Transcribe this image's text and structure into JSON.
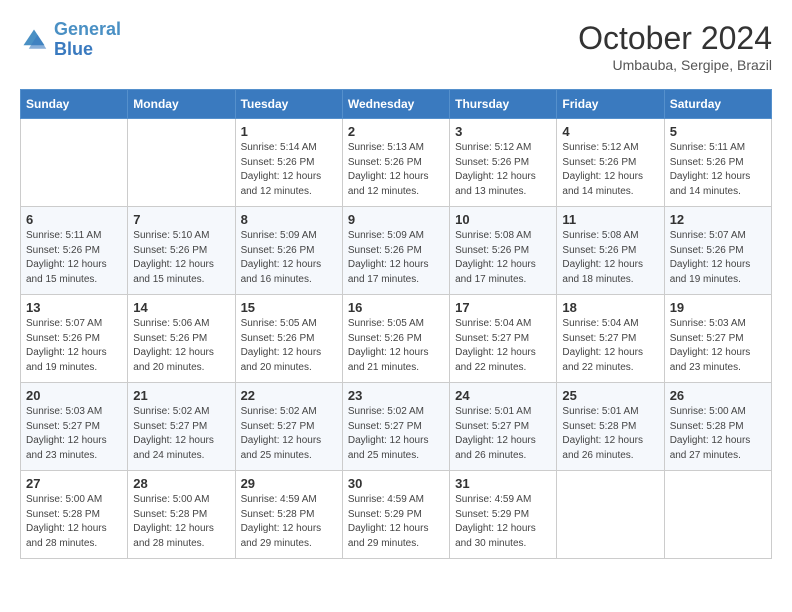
{
  "header": {
    "logo_line1": "General",
    "logo_line2": "Blue",
    "month": "October 2024",
    "location": "Umbauba, Sergipe, Brazil"
  },
  "days_of_week": [
    "Sunday",
    "Monday",
    "Tuesday",
    "Wednesday",
    "Thursday",
    "Friday",
    "Saturday"
  ],
  "weeks": [
    [
      {
        "day": "",
        "detail": ""
      },
      {
        "day": "",
        "detail": ""
      },
      {
        "day": "1",
        "detail": "Sunrise: 5:14 AM\nSunset: 5:26 PM\nDaylight: 12 hours\nand 12 minutes."
      },
      {
        "day": "2",
        "detail": "Sunrise: 5:13 AM\nSunset: 5:26 PM\nDaylight: 12 hours\nand 12 minutes."
      },
      {
        "day": "3",
        "detail": "Sunrise: 5:12 AM\nSunset: 5:26 PM\nDaylight: 12 hours\nand 13 minutes."
      },
      {
        "day": "4",
        "detail": "Sunrise: 5:12 AM\nSunset: 5:26 PM\nDaylight: 12 hours\nand 14 minutes."
      },
      {
        "day": "5",
        "detail": "Sunrise: 5:11 AM\nSunset: 5:26 PM\nDaylight: 12 hours\nand 14 minutes."
      }
    ],
    [
      {
        "day": "6",
        "detail": "Sunrise: 5:11 AM\nSunset: 5:26 PM\nDaylight: 12 hours\nand 15 minutes."
      },
      {
        "day": "7",
        "detail": "Sunrise: 5:10 AM\nSunset: 5:26 PM\nDaylight: 12 hours\nand 15 minutes."
      },
      {
        "day": "8",
        "detail": "Sunrise: 5:09 AM\nSunset: 5:26 PM\nDaylight: 12 hours\nand 16 minutes."
      },
      {
        "day": "9",
        "detail": "Sunrise: 5:09 AM\nSunset: 5:26 PM\nDaylight: 12 hours\nand 17 minutes."
      },
      {
        "day": "10",
        "detail": "Sunrise: 5:08 AM\nSunset: 5:26 PM\nDaylight: 12 hours\nand 17 minutes."
      },
      {
        "day": "11",
        "detail": "Sunrise: 5:08 AM\nSunset: 5:26 PM\nDaylight: 12 hours\nand 18 minutes."
      },
      {
        "day": "12",
        "detail": "Sunrise: 5:07 AM\nSunset: 5:26 PM\nDaylight: 12 hours\nand 19 minutes."
      }
    ],
    [
      {
        "day": "13",
        "detail": "Sunrise: 5:07 AM\nSunset: 5:26 PM\nDaylight: 12 hours\nand 19 minutes."
      },
      {
        "day": "14",
        "detail": "Sunrise: 5:06 AM\nSunset: 5:26 PM\nDaylight: 12 hours\nand 20 minutes."
      },
      {
        "day": "15",
        "detail": "Sunrise: 5:05 AM\nSunset: 5:26 PM\nDaylight: 12 hours\nand 20 minutes."
      },
      {
        "day": "16",
        "detail": "Sunrise: 5:05 AM\nSunset: 5:26 PM\nDaylight: 12 hours\nand 21 minutes."
      },
      {
        "day": "17",
        "detail": "Sunrise: 5:04 AM\nSunset: 5:27 PM\nDaylight: 12 hours\nand 22 minutes."
      },
      {
        "day": "18",
        "detail": "Sunrise: 5:04 AM\nSunset: 5:27 PM\nDaylight: 12 hours\nand 22 minutes."
      },
      {
        "day": "19",
        "detail": "Sunrise: 5:03 AM\nSunset: 5:27 PM\nDaylight: 12 hours\nand 23 minutes."
      }
    ],
    [
      {
        "day": "20",
        "detail": "Sunrise: 5:03 AM\nSunset: 5:27 PM\nDaylight: 12 hours\nand 23 minutes."
      },
      {
        "day": "21",
        "detail": "Sunrise: 5:02 AM\nSunset: 5:27 PM\nDaylight: 12 hours\nand 24 minutes."
      },
      {
        "day": "22",
        "detail": "Sunrise: 5:02 AM\nSunset: 5:27 PM\nDaylight: 12 hours\nand 25 minutes."
      },
      {
        "day": "23",
        "detail": "Sunrise: 5:02 AM\nSunset: 5:27 PM\nDaylight: 12 hours\nand 25 minutes."
      },
      {
        "day": "24",
        "detail": "Sunrise: 5:01 AM\nSunset: 5:27 PM\nDaylight: 12 hours\nand 26 minutes."
      },
      {
        "day": "25",
        "detail": "Sunrise: 5:01 AM\nSunset: 5:28 PM\nDaylight: 12 hours\nand 26 minutes."
      },
      {
        "day": "26",
        "detail": "Sunrise: 5:00 AM\nSunset: 5:28 PM\nDaylight: 12 hours\nand 27 minutes."
      }
    ],
    [
      {
        "day": "27",
        "detail": "Sunrise: 5:00 AM\nSunset: 5:28 PM\nDaylight: 12 hours\nand 28 minutes."
      },
      {
        "day": "28",
        "detail": "Sunrise: 5:00 AM\nSunset: 5:28 PM\nDaylight: 12 hours\nand 28 minutes."
      },
      {
        "day": "29",
        "detail": "Sunrise: 4:59 AM\nSunset: 5:28 PM\nDaylight: 12 hours\nand 29 minutes."
      },
      {
        "day": "30",
        "detail": "Sunrise: 4:59 AM\nSunset: 5:29 PM\nDaylight: 12 hours\nand 29 minutes."
      },
      {
        "day": "31",
        "detail": "Sunrise: 4:59 AM\nSunset: 5:29 PM\nDaylight: 12 hours\nand 30 minutes."
      },
      {
        "day": "",
        "detail": ""
      },
      {
        "day": "",
        "detail": ""
      }
    ]
  ]
}
